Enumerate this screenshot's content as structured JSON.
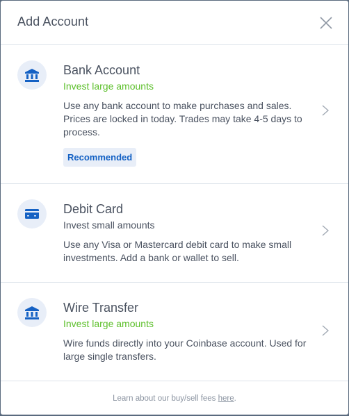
{
  "header": {
    "title": "Add Account",
    "close_icon": "close-icon"
  },
  "options": [
    {
      "icon": "bank-icon",
      "title": "Bank Account",
      "subtitle": "Invest large amounts",
      "subtitle_color": "#5cbf2a",
      "description": "Use any bank account to make purchases and sales. Prices are locked in today. Trades may take 4-5 days to process.",
      "badge": "Recommended"
    },
    {
      "icon": "credit-card-icon",
      "title": "Debit Card",
      "subtitle": "Invest small amounts",
      "subtitle_color": "#4a5260",
      "description": "Use any Visa or Mastercard debit card to make small investments. Add a bank or wallet to sell."
    },
    {
      "icon": "bank-icon",
      "title": "Wire Transfer",
      "subtitle": "Invest large amounts",
      "subtitle_color": "#5cbf2a",
      "description": "Wire funds directly into your Coinbase account. Used for large single transfers."
    }
  ],
  "footer": {
    "text": "Learn about our buy/sell fees ",
    "link": "here",
    "suffix": "."
  },
  "colors": {
    "accent": "#1461c4",
    "green": "#5cbf2a",
    "icon_bg": "#e8eef8"
  }
}
